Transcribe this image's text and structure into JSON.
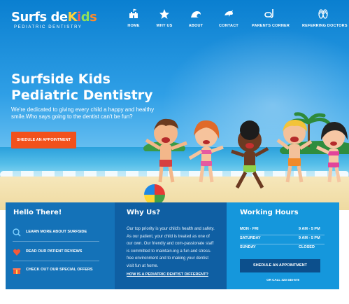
{
  "logo": {
    "name_parts": [
      "Surfs",
      "de",
      "K",
      "i",
      "d",
      "s"
    ],
    "subtitle": "PEDIATRIC DENTISTRY"
  },
  "nav": {
    "items": [
      {
        "label": "HOME",
        "icon": "castle-icon"
      },
      {
        "label": "WHY US",
        "icon": "starfish-icon"
      },
      {
        "label": "ABOUT",
        "icon": "wave-icon"
      },
      {
        "label": "CONTACT",
        "icon": "dolphin-icon"
      },
      {
        "label": "PARENTS CORNER",
        "icon": "snorkel-icon"
      },
      {
        "label": "REFERRING DOCTORS",
        "icon": "flip-flops-icon"
      }
    ]
  },
  "hero": {
    "title_line1": "Surfside Kids",
    "title_line2": "Pediatric Dentistry",
    "text": "We're dedicated to giving every child a happy and healthy smile.Who says going to the dentist can't be fun?",
    "button": "SHEDULE AN APPOINTMENT"
  },
  "panels": {
    "hello": {
      "title": "Hello There!",
      "links": [
        {
          "label": "LEARN MORE ABOUT SURFSIDE",
          "icon": "tooth-search-icon"
        },
        {
          "label": "READ OUR PATIENT REVIEWS",
          "icon": "heart-icon"
        },
        {
          "label": "CHECK OUT OUR SPECIAL OFFERS",
          "icon": "gift-icon"
        }
      ]
    },
    "why": {
      "title": "Why Us?",
      "body": "Our top priority is your child's health and safety. As our patient, your child is treated as one of our own. Our friendly and com-passionate staff is committed to maintain-ing a fun and stress-free environment and to making your dentist visit fun at home.",
      "link": "HOW IS A PEDIATRIC DENTIST DIFFERENT?"
    },
    "hours": {
      "title": "Working Hours",
      "rows": [
        {
          "day": "MON - FRI",
          "time": "9 AM - 5 PM"
        },
        {
          "day": "SATURDAY",
          "time": "9 AM - 5 PM"
        },
        {
          "day": "SUNDAY",
          "time": "CLOSED"
        }
      ],
      "button": "SHEDULE AN APPOINTMENT",
      "call": "OR CALL 323-345-678"
    }
  },
  "colors": {
    "accent_orange": "#f2511b",
    "panel_left": "#1472b8",
    "panel_mid": "#0f5fa3",
    "panel_right": "#1597dc"
  }
}
